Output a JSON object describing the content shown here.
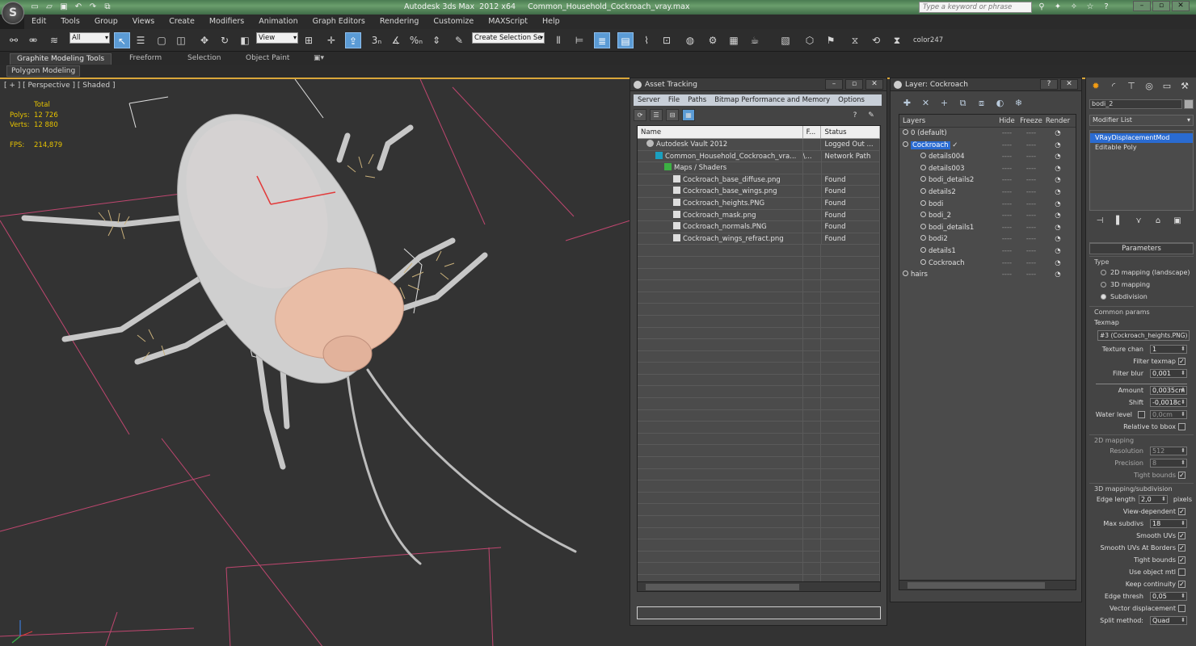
{
  "app": {
    "title": "Autodesk 3ds Max  2012 x64     Common_Household_Cockroach_vray.max",
    "logo_letter": "S",
    "search_placeholder": "Type a keyword or phrase",
    "quick_access_icons": [
      "new-file-icon",
      "open-file-icon",
      "save-icon",
      "undo-icon",
      "redo-icon",
      "project-icon"
    ]
  },
  "menu": [
    "Edit",
    "Tools",
    "Group",
    "Views",
    "Create",
    "Modifiers",
    "Animation",
    "Graph Editors",
    "Rendering",
    "Customize",
    "MAXScript",
    "Help"
  ],
  "toolbar": {
    "selection_filter": "All",
    "coord_system": "View",
    "selection_set": "Create Selection Se",
    "color_label": "color247"
  },
  "ribbon": {
    "tabs": [
      "Graphite Modeling Tools",
      "Freeform",
      "Selection",
      "Object Paint"
    ],
    "active_tab": "Graphite Modeling Tools",
    "panel": "Polygon Modeling"
  },
  "viewport": {
    "label": "[ + ] [ Perspective ] [ Shaded ]",
    "stats": {
      "total_label": "Total",
      "polys_label": "Polys:",
      "polys": "12 726",
      "verts_label": "Verts:",
      "verts": "12 880",
      "fps_label": "FPS:",
      "fps": "214,879"
    },
    "stats_color": "#e6c200"
  },
  "asset_tracking": {
    "title": "Asset Tracking",
    "menu": [
      "Server",
      "File",
      "Paths",
      "Bitmap Performance and Memory",
      "Options"
    ],
    "columns": [
      "Name",
      "F...",
      "Status"
    ],
    "rows": [
      {
        "name": "Autodesk Vault 2012",
        "f": "",
        "status": "Logged Out ...",
        "indent": 1,
        "icon": "vault"
      },
      {
        "name": "Common_Household_Cockroach_vra...",
        "f": "\\...",
        "status": "Network Path",
        "indent": 2,
        "icon": "max"
      },
      {
        "name": "Maps / Shaders",
        "f": "",
        "status": "",
        "indent": 3,
        "icon": "folder"
      },
      {
        "name": "Cockroach_base_diffuse.png",
        "f": "",
        "status": "Found",
        "indent": 4,
        "icon": "file"
      },
      {
        "name": "Cockroach_base_wings.png",
        "f": "",
        "status": "Found",
        "indent": 4,
        "icon": "file"
      },
      {
        "name": "Cockroach_heights.PNG",
        "f": "",
        "status": "Found",
        "indent": 4,
        "icon": "file"
      },
      {
        "name": "Cockroach_mask.png",
        "f": "",
        "status": "Found",
        "indent": 4,
        "icon": "file"
      },
      {
        "name": "Cockroach_normals.PNG",
        "f": "",
        "status": "Found",
        "indent": 4,
        "icon": "file"
      },
      {
        "name": "Cockroach_wings_refract.png",
        "f": "",
        "status": "Found",
        "indent": 4,
        "icon": "file"
      }
    ]
  },
  "layer_panel": {
    "title": "Layer: Cockroach",
    "columns": [
      "Layers",
      "Hide",
      "Freeze",
      "Render"
    ],
    "rows": [
      {
        "name": "0 (default)",
        "type": "layer",
        "indent": 1,
        "selected": false
      },
      {
        "name": "Cockroach",
        "type": "layer",
        "indent": 1,
        "selected": true
      },
      {
        "name": "details004",
        "type": "object",
        "indent": 2
      },
      {
        "name": "details003",
        "type": "object",
        "indent": 2
      },
      {
        "name": "bodi_details2",
        "type": "object",
        "indent": 2
      },
      {
        "name": "details2",
        "type": "object",
        "indent": 2
      },
      {
        "name": "bodi",
        "type": "object",
        "indent": 2
      },
      {
        "name": "bodi_2",
        "type": "object",
        "indent": 2
      },
      {
        "name": "bodi_details1",
        "type": "object",
        "indent": 2
      },
      {
        "name": "bodi2",
        "type": "object",
        "indent": 2
      },
      {
        "name": "details1",
        "type": "object",
        "indent": 2
      },
      {
        "name": "Cockroach",
        "type": "object",
        "indent": 2
      },
      {
        "name": "hairs",
        "type": "layer",
        "indent": 1,
        "selected": false
      }
    ],
    "dash": "----"
  },
  "command_panel": {
    "object_name": "bodi_2",
    "modifier_list": "Modifier List",
    "stack": [
      "VRayDisplacementMod",
      "Editable Poly"
    ],
    "rollout_title": "Parameters",
    "type_group": "Type",
    "type_options": [
      "2D mapping (landscape)",
      "3D mapping",
      "Subdivision"
    ],
    "type_selected": 2,
    "common_group": "Common params",
    "texmap_label": "Texmap",
    "texmap_value": "#3 (Cockroach_heights.PNG)",
    "texture_chan_label": "Texture chan",
    "texture_chan": "1",
    "filter_texmap_label": "Filter texmap",
    "filter_blur_label": "Filter blur",
    "filter_blur": "0,001",
    "amount_label": "Amount",
    "amount": "0,0035cm",
    "shift_label": "Shift",
    "shift": "-0,0018c",
    "water_level_label": "Water level",
    "water_level": "0,0cm",
    "relative_bbox_label": "Relative to bbox",
    "mapping2d_group": "2D mapping",
    "resolution_label": "Resolution",
    "resolution": "512",
    "precision_label": "Precision",
    "precision": "8",
    "tight_bounds_label": "Tight bounds",
    "mapping3d_group": "3D mapping/subdivision",
    "edge_length_label": "Edge length",
    "edge_length": "2,0",
    "pixels_label": "pixels",
    "view_dependent_label": "View-dependent",
    "max_subdivs_label": "Max subdivs",
    "max_subdivs": "18",
    "smooth_uvs_label": "Smooth UVs",
    "smooth_uvs_borders_label": "Smooth UVs At Borders",
    "tight_bounds2_label": "Tight bounds",
    "use_object_mtl_label": "Use object mtl",
    "keep_continuity_label": "Keep continuity",
    "edge_thresh_label": "Edge thresh",
    "edge_thresh": "0,05",
    "vector_disp_label": "Vector displacement",
    "split_method_label": "Split method:",
    "split_method": "Quad"
  }
}
